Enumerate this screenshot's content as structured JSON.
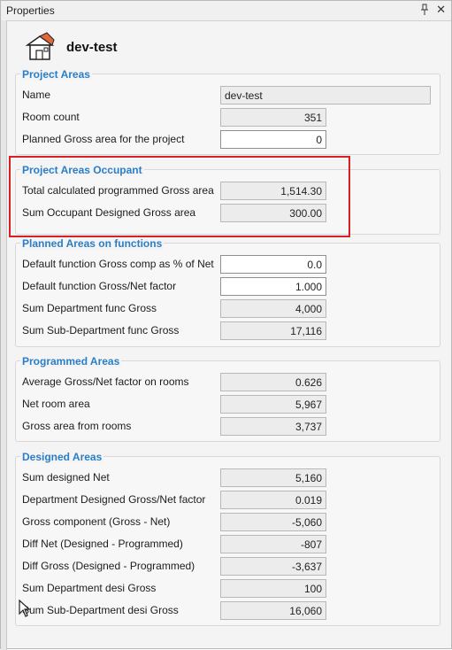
{
  "window": {
    "title": "Properties"
  },
  "header": {
    "project_name": "dev-test",
    "icon": "house-icon"
  },
  "sections": {
    "project_areas": {
      "title": "Project Areas",
      "rows": [
        {
          "label": "Name",
          "value": "dev-test"
        },
        {
          "label": "Room count",
          "value": "351"
        },
        {
          "label": "Planned Gross area for the project",
          "value": "0"
        }
      ]
    },
    "project_areas_occupant": {
      "title": "Project Areas Occupant",
      "rows": [
        {
          "label": "Total calculated programmed Gross area",
          "value": "1,514.30"
        },
        {
          "label": "Sum Occupant Designed Gross area",
          "value": "300.00"
        }
      ]
    },
    "planned_areas_on_functions": {
      "title": "Planned Areas on functions",
      "rows": [
        {
          "label": "Default function Gross comp as % of Net",
          "value": "0.0"
        },
        {
          "label": "Default function Gross/Net factor",
          "value": "1.000"
        },
        {
          "label": "Sum Department func Gross",
          "value": "4,000"
        },
        {
          "label": "Sum Sub-Department func Gross",
          "value": "17,116"
        }
      ]
    },
    "programmed_areas": {
      "title": "Programmed Areas",
      "rows": [
        {
          "label": "Average Gross/Net factor on rooms",
          "value": "0.626"
        },
        {
          "label": "Net room area",
          "value": "5,967"
        },
        {
          "label": "Gross area from rooms",
          "value": "3,737"
        }
      ]
    },
    "designed_areas": {
      "title": "Designed Areas",
      "rows": [
        {
          "label": "Sum designed Net",
          "value": "5,160"
        },
        {
          "label": "Department Designed Gross/Net factor",
          "value": "0.019"
        },
        {
          "label": "Gross component (Gross - Net)",
          "value": "-5,060"
        },
        {
          "label": "Diff Net (Designed - Programmed)",
          "value": "-807"
        },
        {
          "label": "Diff Gross (Designed - Programmed)",
          "value": "-3,637"
        },
        {
          "label": "Sum Department desi Gross",
          "value": "100"
        },
        {
          "label": "Sum Sub-Department desi Gross",
          "value": "16,060"
        }
      ]
    }
  },
  "colors": {
    "section_title": "#2a7ec6",
    "highlight": "#d81f26"
  }
}
